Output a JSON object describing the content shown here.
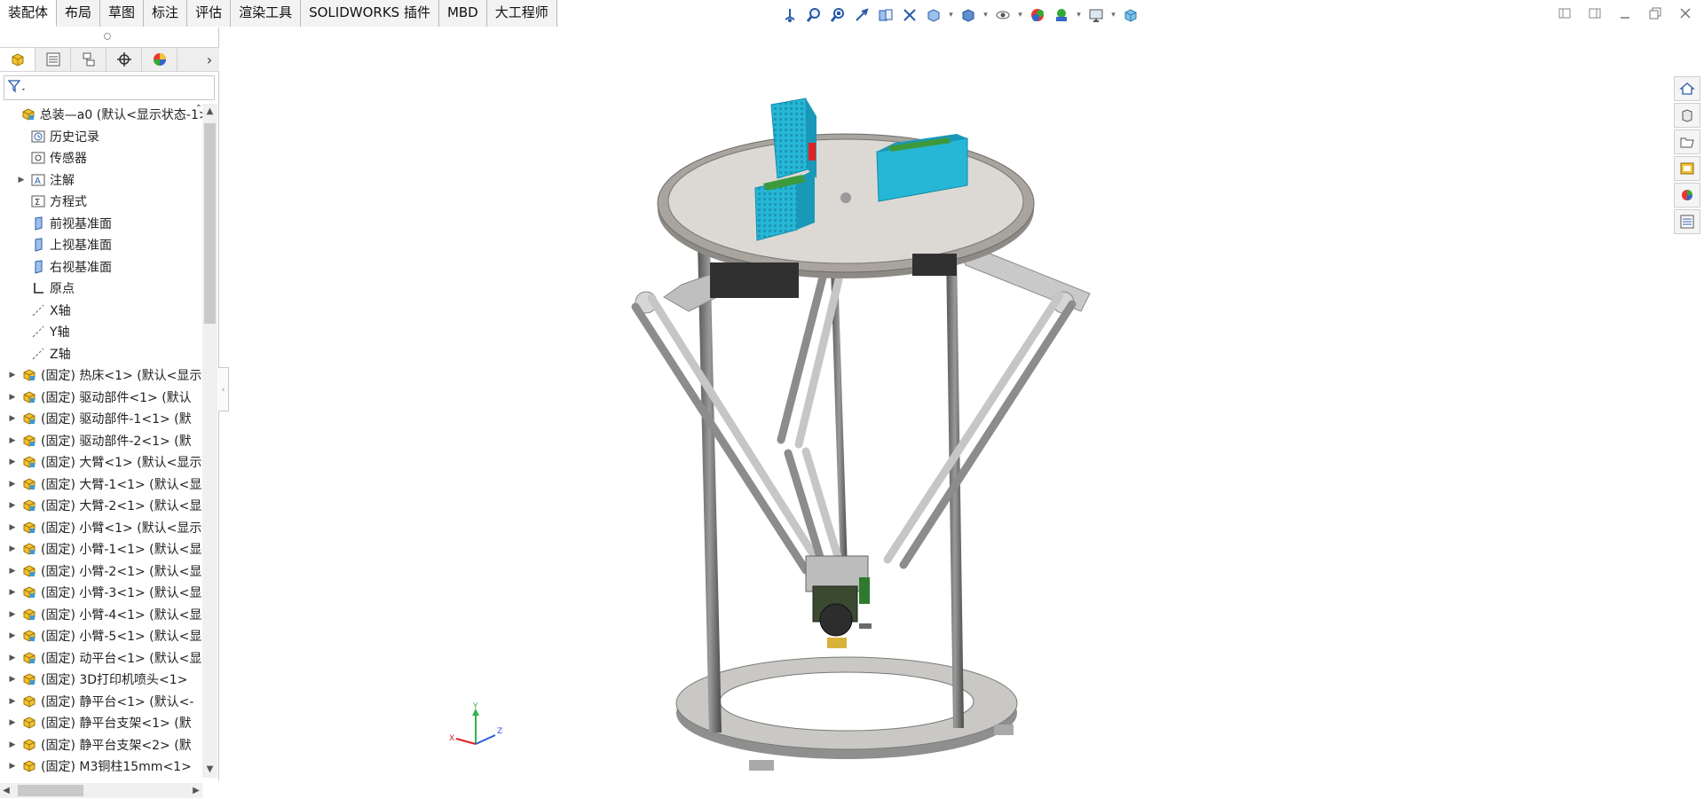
{
  "tabs": [
    {
      "label": "装配体"
    },
    {
      "label": "布局"
    },
    {
      "label": "草图"
    },
    {
      "label": "标注"
    },
    {
      "label": "评估"
    },
    {
      "label": "渲染工具"
    },
    {
      "label": "SOLIDWORKS 插件"
    },
    {
      "label": "MBD"
    },
    {
      "label": "大工程师"
    }
  ],
  "heads_up_toolbar": [
    "view-orientation-icon",
    "zoom-to-fit-icon",
    "zoom-area-icon",
    "previous-view-icon",
    "section-view-icon",
    "dynamic-annotation-icon",
    "view-orientation-cube-icon",
    "display-style-icon",
    "hide-show-icon",
    "edit-appearance-icon",
    "apply-scene-icon",
    "view-settings-icon",
    "3d-view-icon"
  ],
  "tree": {
    "items": [
      {
        "label": "总装—a0  (默认<显示状态-1>",
        "icon": "assembly-icon",
        "expander": "",
        "indent": 0
      },
      {
        "label": "历史记录",
        "icon": "history-icon",
        "expander": "",
        "indent": 1
      },
      {
        "label": "传感器",
        "icon": "sensor-icon",
        "expander": "",
        "indent": 1
      },
      {
        "label": "注解",
        "icon": "annotation-icon",
        "expander": "▶",
        "indent": 1
      },
      {
        "label": "方程式",
        "icon": "equation-icon",
        "expander": "",
        "indent": 1
      },
      {
        "label": "前视基准面",
        "icon": "plane-icon",
        "expander": "",
        "indent": 1
      },
      {
        "label": "上视基准面",
        "icon": "plane-icon",
        "expander": "",
        "indent": 1
      },
      {
        "label": "右视基准面",
        "icon": "plane-icon",
        "expander": "",
        "indent": 1
      },
      {
        "label": "原点",
        "icon": "origin-icon",
        "expander": "",
        "indent": 1
      },
      {
        "label": "X轴",
        "icon": "axis-icon",
        "expander": "",
        "indent": 1
      },
      {
        "label": "Y轴",
        "icon": "axis-icon",
        "expander": "",
        "indent": 1
      },
      {
        "label": "Z轴",
        "icon": "axis-icon",
        "expander": "",
        "indent": 1
      },
      {
        "label": "(固定) 热床<1> (默认<显示",
        "icon": "part-icon",
        "expander": "▶",
        "indent": 0
      },
      {
        "label": "(固定) 驱动部件<1> (默认",
        "icon": "part-icon",
        "expander": "▶",
        "indent": 0
      },
      {
        "label": "(固定) 驱动部件-1<1> (默",
        "icon": "part-icon",
        "expander": "▶",
        "indent": 0
      },
      {
        "label": "(固定) 驱动部件-2<1> (默",
        "icon": "part-icon",
        "expander": "▶",
        "indent": 0
      },
      {
        "label": "(固定) 大臂<1> (默认<显示",
        "icon": "part-icon",
        "expander": "▶",
        "indent": 0
      },
      {
        "label": "(固定) 大臂-1<1> (默认<显",
        "icon": "part-icon",
        "expander": "▶",
        "indent": 0
      },
      {
        "label": "(固定) 大臂-2<1> (默认<显",
        "icon": "part-icon",
        "expander": "▶",
        "indent": 0
      },
      {
        "label": "(固定) 小臂<1> (默认<显示",
        "icon": "part-icon",
        "expander": "▶",
        "indent": 0
      },
      {
        "label": "(固定) 小臂-1<1> (默认<显",
        "icon": "part-icon",
        "expander": "▶",
        "indent": 0
      },
      {
        "label": "(固定) 小臂-2<1> (默认<显",
        "icon": "part-icon",
        "expander": "▶",
        "indent": 0
      },
      {
        "label": "(固定) 小臂-3<1> (默认<显",
        "icon": "part-icon",
        "expander": "▶",
        "indent": 0
      },
      {
        "label": "(固定) 小臂-4<1> (默认<显",
        "icon": "part-icon",
        "expander": "▶",
        "indent": 0
      },
      {
        "label": "(固定) 小臂-5<1> (默认<显",
        "icon": "part-icon",
        "expander": "▶",
        "indent": 0
      },
      {
        "label": "(固定) 动平台<1> (默认<显",
        "icon": "part-icon",
        "expander": "▶",
        "indent": 0
      },
      {
        "label": "(固定) 3D打印机喷头<1>",
        "icon": "part-icon",
        "expander": "▶",
        "indent": 0
      },
      {
        "label": "(固定) 静平台<1> (默认<-",
        "icon": "subassembly-icon",
        "expander": "▶",
        "indent": 0
      },
      {
        "label": "(固定) 静平台支架<1> (默",
        "icon": "subassembly-icon",
        "expander": "▶",
        "indent": 0
      },
      {
        "label": "(固定) 静平台支架<2> (默",
        "icon": "subassembly-icon",
        "expander": "▶",
        "indent": 0
      },
      {
        "label": "(固定) M3铜柱15mm<1>",
        "icon": "subassembly-icon",
        "expander": "▶",
        "indent": 0
      }
    ]
  },
  "triad": {
    "x": "X",
    "y": "Y",
    "z": "Z"
  },
  "colors": {
    "accent": "#1e6fd9",
    "driver": "#27b7d6",
    "metal": "#b9b9b9"
  }
}
